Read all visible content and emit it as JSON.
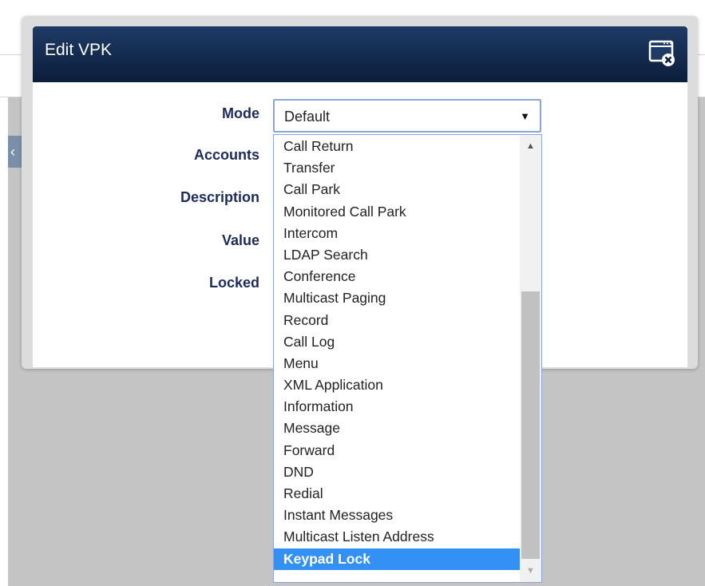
{
  "dialog": {
    "title": "Edit VPK"
  },
  "form": {
    "labels": {
      "mode": "Mode",
      "accounts": "Accounts",
      "description": "Description",
      "value": "Value",
      "locked": "Locked"
    },
    "mode_select": {
      "selected": "Default",
      "options": [
        "Call Return",
        "Transfer",
        "Call Park",
        "Monitored Call Park",
        "Intercom",
        "LDAP Search",
        "Conference",
        "Multicast Paging",
        "Record",
        "Call Log",
        "Menu",
        "XML Application",
        "Information",
        "Message",
        "Forward",
        "DND",
        "Redial",
        "Instant Messages",
        "Multicast Listen Address",
        "Keypad Lock"
      ],
      "highlighted": "Keypad Lock"
    }
  },
  "icons": {
    "close": "close-window-icon",
    "arrow": "chevron-down-icon"
  },
  "colors": {
    "header": "#0b1d3a",
    "label": "#1d2b5c",
    "highlight": "#3391f5"
  }
}
